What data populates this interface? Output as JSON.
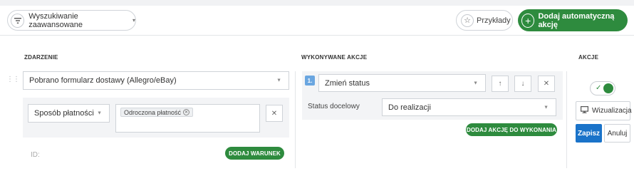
{
  "toolbar": {
    "advanced_search_label": "Wyszukiwanie zaawansowane",
    "examples_label": "Przykłady",
    "add_automatic_action_label": "Dodaj automatyczną akcję"
  },
  "columns": {
    "event": "ZDARZENIE",
    "actions_performed": "WYKONYWANE AKCJE",
    "actions": "AKCJE"
  },
  "event": {
    "trigger_value": "Pobrano formularz dostawy (Allegro/eBay)",
    "condition_field": "Sposób płatności",
    "condition_tag": "Odroczona płatność",
    "add_condition_label": "DODAJ WARUNEK",
    "id_label": "ID:"
  },
  "action": {
    "number": "1.",
    "type_value": "Zmień status",
    "target_status_label": "Status docelowy",
    "target_status_value": "Do realizacji",
    "add_action_label": "DODAJ AKCJĘ DO WYKONANIA"
  },
  "controls": {
    "visualization_label": "Wizualizacja",
    "save_label": "Zapisz",
    "cancel_label": "Anuluj",
    "enabled": true
  },
  "colors": {
    "accent_green": "#2e8b3e",
    "save_blue": "#1a73c9",
    "badge_blue": "#6aa6e0"
  }
}
